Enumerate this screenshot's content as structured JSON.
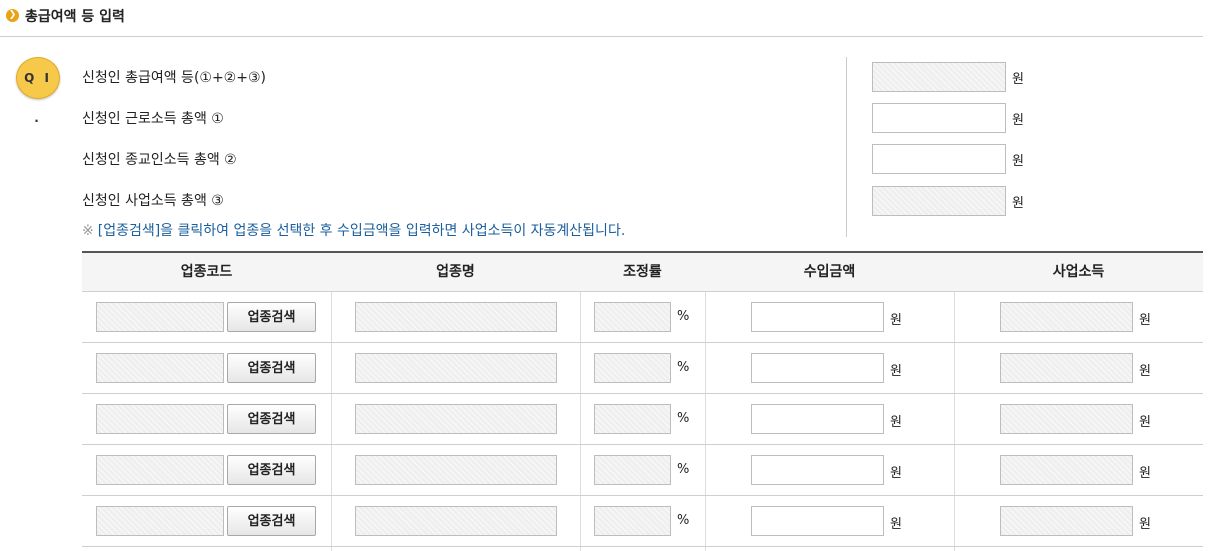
{
  "section": {
    "title": "총급여액 등 입력",
    "icon": "circle-arrow-right-icon"
  },
  "question": {
    "badge": "Q I .",
    "lines": [
      {
        "label": "신청인 총급여액 등(①+②+③)",
        "value": "",
        "unit": "원",
        "readonly": true
      },
      {
        "label": "신청인 근로소득 총액 ①",
        "value": "",
        "unit": "원",
        "readonly": false
      },
      {
        "label": "신청인 종교인소득 총액 ②",
        "value": "",
        "unit": "원",
        "readonly": false
      },
      {
        "label": "신청인 사업소득 총액 ③",
        "value": "",
        "unit": "원",
        "readonly": true
      }
    ],
    "note_mark": "※",
    "note": "[업종검색]을 클릭하여 업종을 선택한 후 수입금액을 입력하면 사업소득이 자동계산됩니다."
  },
  "table": {
    "headers": [
      "업종코드",
      "업종명",
      "조정률",
      "수입금액",
      "사업소득"
    ],
    "search_button_label": "업종검색",
    "percent_unit": "%",
    "won_unit": "원",
    "rows": [
      {
        "code": "",
        "name": "",
        "rate": "",
        "income": "",
        "business_income": ""
      },
      {
        "code": "",
        "name": "",
        "rate": "",
        "income": "",
        "business_income": ""
      },
      {
        "code": "",
        "name": "",
        "rate": "",
        "income": "",
        "business_income": ""
      },
      {
        "code": "",
        "name": "",
        "rate": "",
        "income": "",
        "business_income": ""
      },
      {
        "code": "",
        "name": "",
        "rate": "",
        "income": "",
        "business_income": ""
      }
    ]
  }
}
